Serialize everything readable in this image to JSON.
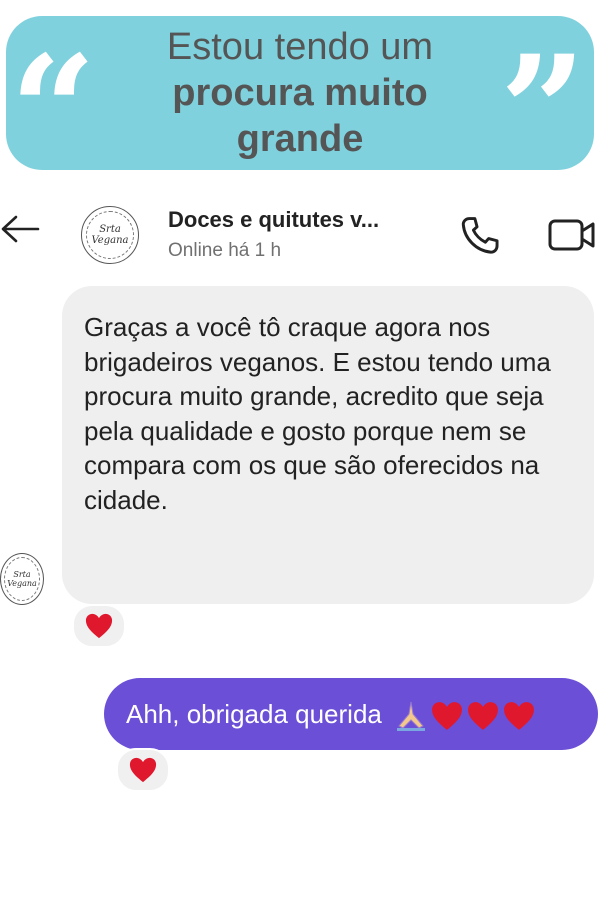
{
  "banner": {
    "line1": "Estou tendo um",
    "line2": "procura muito",
    "line3": "grande",
    "quote_open": "“",
    "quote_close": "”",
    "background": "#7fd1dd"
  },
  "header": {
    "contact_name": "Doces e quitutes v...",
    "status": "Online há 1 h",
    "avatar_text_1": "Srta",
    "avatar_text_2": "Vegana",
    "icons": [
      "back-arrow-icon",
      "phone-icon",
      "video-camera-icon"
    ]
  },
  "messages": [
    {
      "direction": "incoming",
      "text": "Graças a você tô craque agora nos brigadeiros veganos. E estou tendo uma procura muito grande, acredito que seja pela qualidade e gosto porque nem se compara com os que são oferecidos na cidade.",
      "reaction": "heart-emoji",
      "avatar_text_1": "Srta",
      "avatar_text_2": "Vegana"
    },
    {
      "direction": "outgoing",
      "text": "Ahh, obrigada querida",
      "emojis": [
        "praying-hands-emoji",
        "heart-emoji",
        "heart-emoji",
        "heart-emoji"
      ],
      "reaction": "heart-emoji",
      "bubble_color": "#6b4fd6"
    }
  ]
}
